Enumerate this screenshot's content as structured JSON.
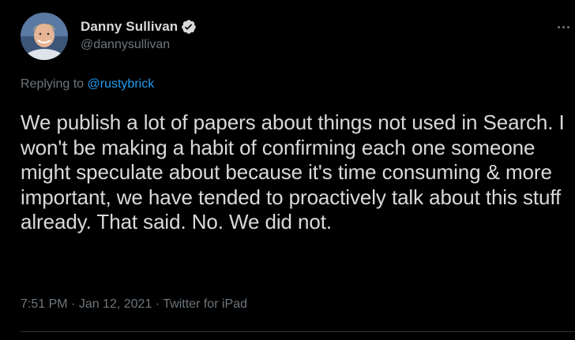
{
  "author": {
    "display_name": "Danny Sullivan",
    "handle": "@dannysullivan",
    "verified": true,
    "avatar_icon": "profile-photo"
  },
  "reply": {
    "prefix": "Replying to",
    "mention": "@rustybrick"
  },
  "tweet": {
    "text": "We publish a lot of papers about things not used in Search. I won't be making a habit of confirming each one someone might speculate about because it's time consuming & more important, we have tended to proactively talk about this stuff already. That said. No. We did not."
  },
  "meta": {
    "time": "7:51 PM",
    "separator": " · ",
    "date": "Jan 12, 2021",
    "source": "Twitter for iPad"
  },
  "colors": {
    "background": "#000000",
    "text": "#d9d9d9",
    "secondary": "#6e767d",
    "accent": "#1d9bf0"
  }
}
